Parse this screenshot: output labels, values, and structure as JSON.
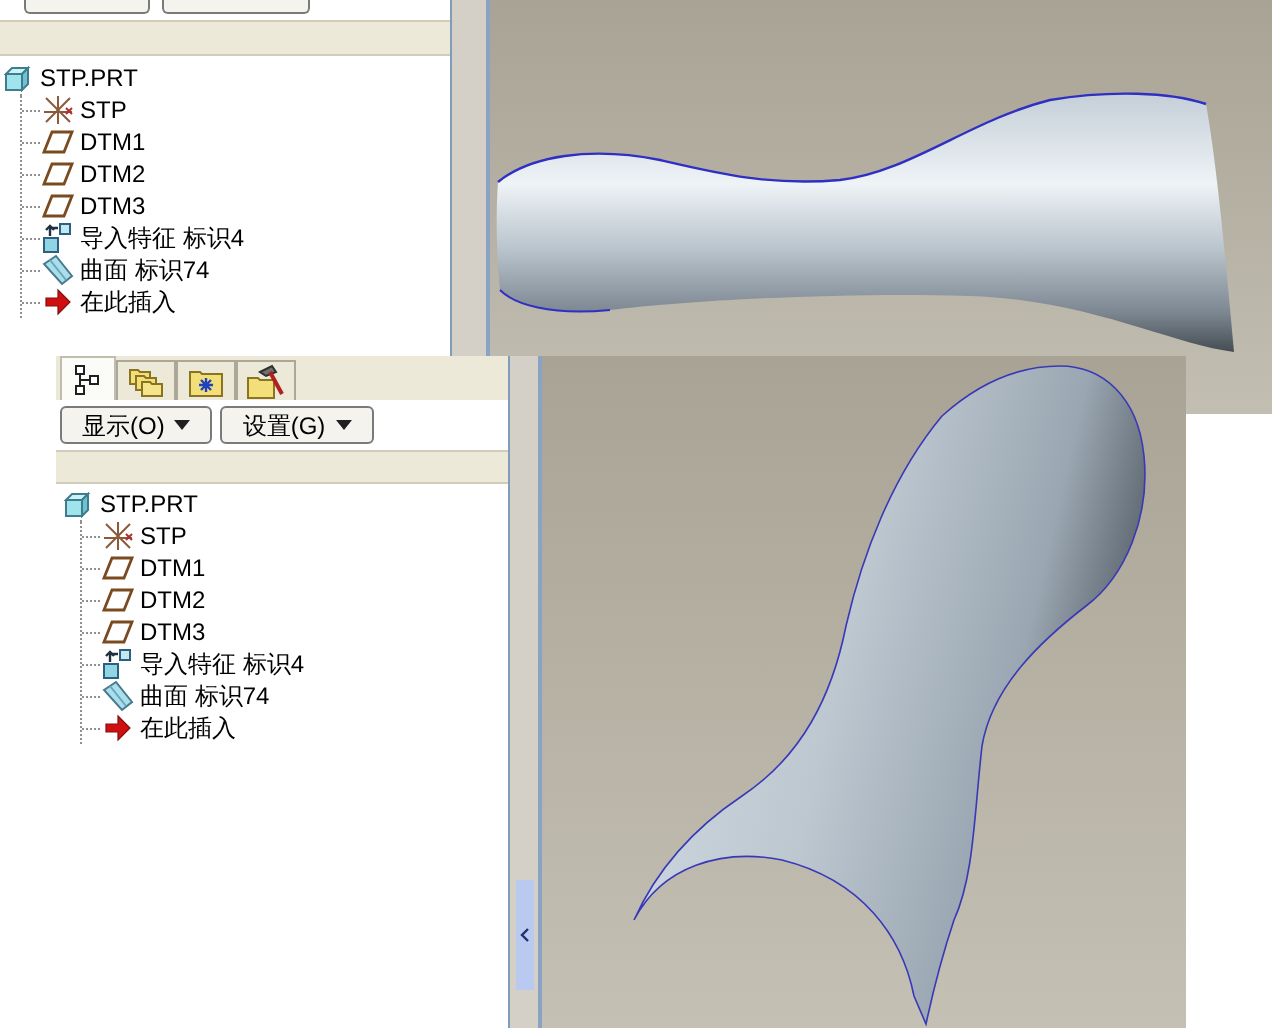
{
  "screenshots": [
    {
      "model_tree": [
        {
          "kind": "part",
          "label": "STP.PRT",
          "children": [
            {
              "kind": "csys",
              "label": "STP"
            },
            {
              "kind": "datum_plane",
              "label": "DTM1"
            },
            {
              "kind": "datum_plane",
              "label": "DTM2"
            },
            {
              "kind": "datum_plane",
              "label": "DTM3"
            },
            {
              "kind": "import",
              "label": "导入特征 标识4"
            },
            {
              "kind": "surface",
              "label": "曲面 标识74"
            },
            {
              "kind": "insert_here",
              "label": "在此插入"
            }
          ]
        }
      ]
    },
    {
      "tabs": [
        {
          "kind": "model_tree",
          "selected": true
        },
        {
          "kind": "folder_browser",
          "selected": false
        },
        {
          "kind": "favorites",
          "selected": false
        },
        {
          "kind": "tools",
          "selected": false
        }
      ],
      "buttons": [
        {
          "label": "显示(O)"
        },
        {
          "label": "设置(G)"
        }
      ],
      "model_tree": [
        {
          "kind": "part",
          "label": "STP.PRT",
          "children": [
            {
              "kind": "csys",
              "label": "STP"
            },
            {
              "kind": "datum_plane",
              "label": "DTM1"
            },
            {
              "kind": "datum_plane",
              "label": "DTM2"
            },
            {
              "kind": "datum_plane",
              "label": "DTM3"
            },
            {
              "kind": "import",
              "label": "导入特征 标识4"
            },
            {
              "kind": "surface",
              "label": "曲面 标识74"
            },
            {
              "kind": "insert_here",
              "label": "在此插入"
            }
          ]
        }
      ]
    }
  ]
}
